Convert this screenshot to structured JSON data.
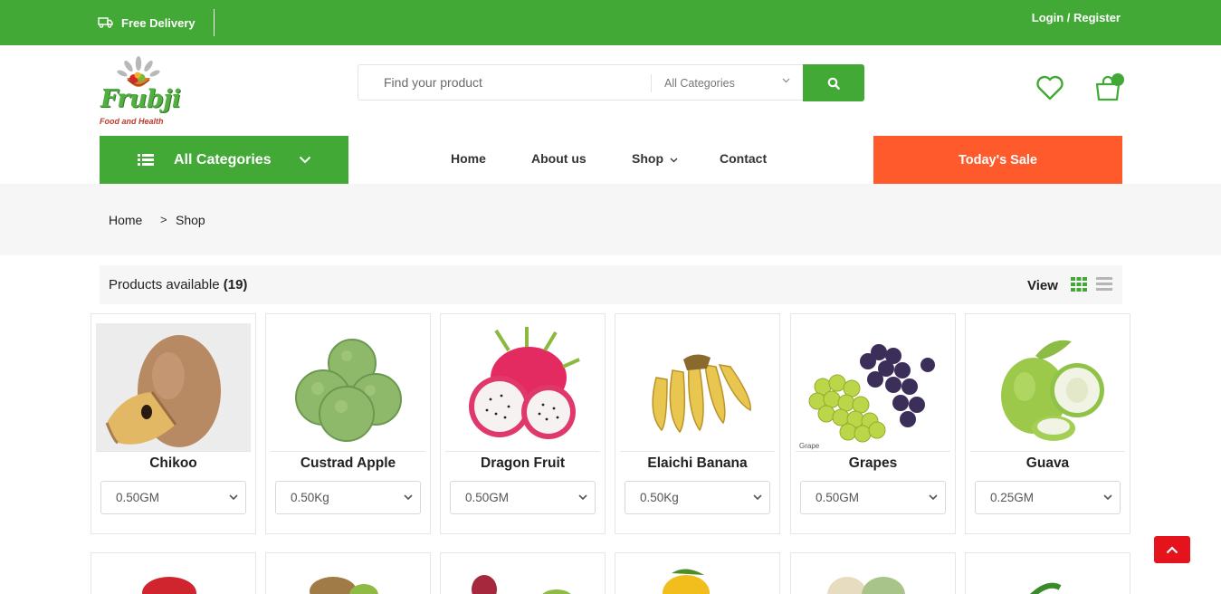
{
  "topbar": {
    "delivery_label": "Free Delivery",
    "login_label": "Login / Register"
  },
  "brand": {
    "name": "Frubji",
    "tagline": "Food and Health"
  },
  "search": {
    "placeholder": "Find your product",
    "category_selected": "All Categories"
  },
  "nav": {
    "all_categories_label": "All Categories",
    "items": [
      {
        "label": "Home"
      },
      {
        "label": "About us"
      },
      {
        "label": "Shop"
      },
      {
        "label": "Contact"
      }
    ],
    "sale_label": "Today's Sale"
  },
  "breadcrumb": {
    "home": "Home",
    "separator": ">",
    "current": "Shop"
  },
  "toolbar": {
    "available_label": "Products available",
    "available_count": "(19)",
    "view_label": "View"
  },
  "products": [
    {
      "name": "Chikoo",
      "quantity": "0.50GM",
      "icon": "chikoo-image"
    },
    {
      "name": "Custrad Apple",
      "quantity": "0.50Kg",
      "icon": "custard-apple-image"
    },
    {
      "name": "Dragon Fruit",
      "quantity": "0.50GM",
      "icon": "dragon-fruit-image"
    },
    {
      "name": "Elaichi Banana",
      "quantity": "0.50Kg",
      "icon": "banana-image"
    },
    {
      "name": "Grapes",
      "quantity": "0.50GM",
      "icon": "grapes-image",
      "image_caption": "Grape"
    },
    {
      "name": "Guava",
      "quantity": "0.25GM",
      "icon": "guava-image"
    }
  ],
  "colors": {
    "brand_green": "#42a936",
    "sale_orange": "#fe5a2c",
    "scroll_top_red": "#e5141c"
  }
}
